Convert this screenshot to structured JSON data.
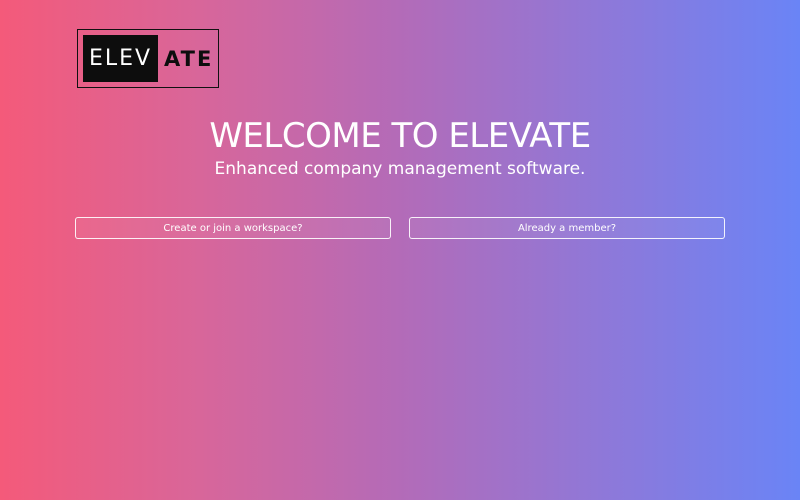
{
  "logo": {
    "left_text": "ELEV",
    "right_text": "ATE"
  },
  "hero": {
    "title": "WELCOME TO ELEVATE",
    "subtitle": "Enhanced company management software."
  },
  "actions": {
    "create_join_label": "Create or join a workspace?",
    "member_label": "Already a member?"
  },
  "colors": {
    "gradient_start": "#f45a7a",
    "gradient_end": "#6a84f6",
    "text": "#ffffff",
    "logo_dark": "#0d0d0d"
  }
}
